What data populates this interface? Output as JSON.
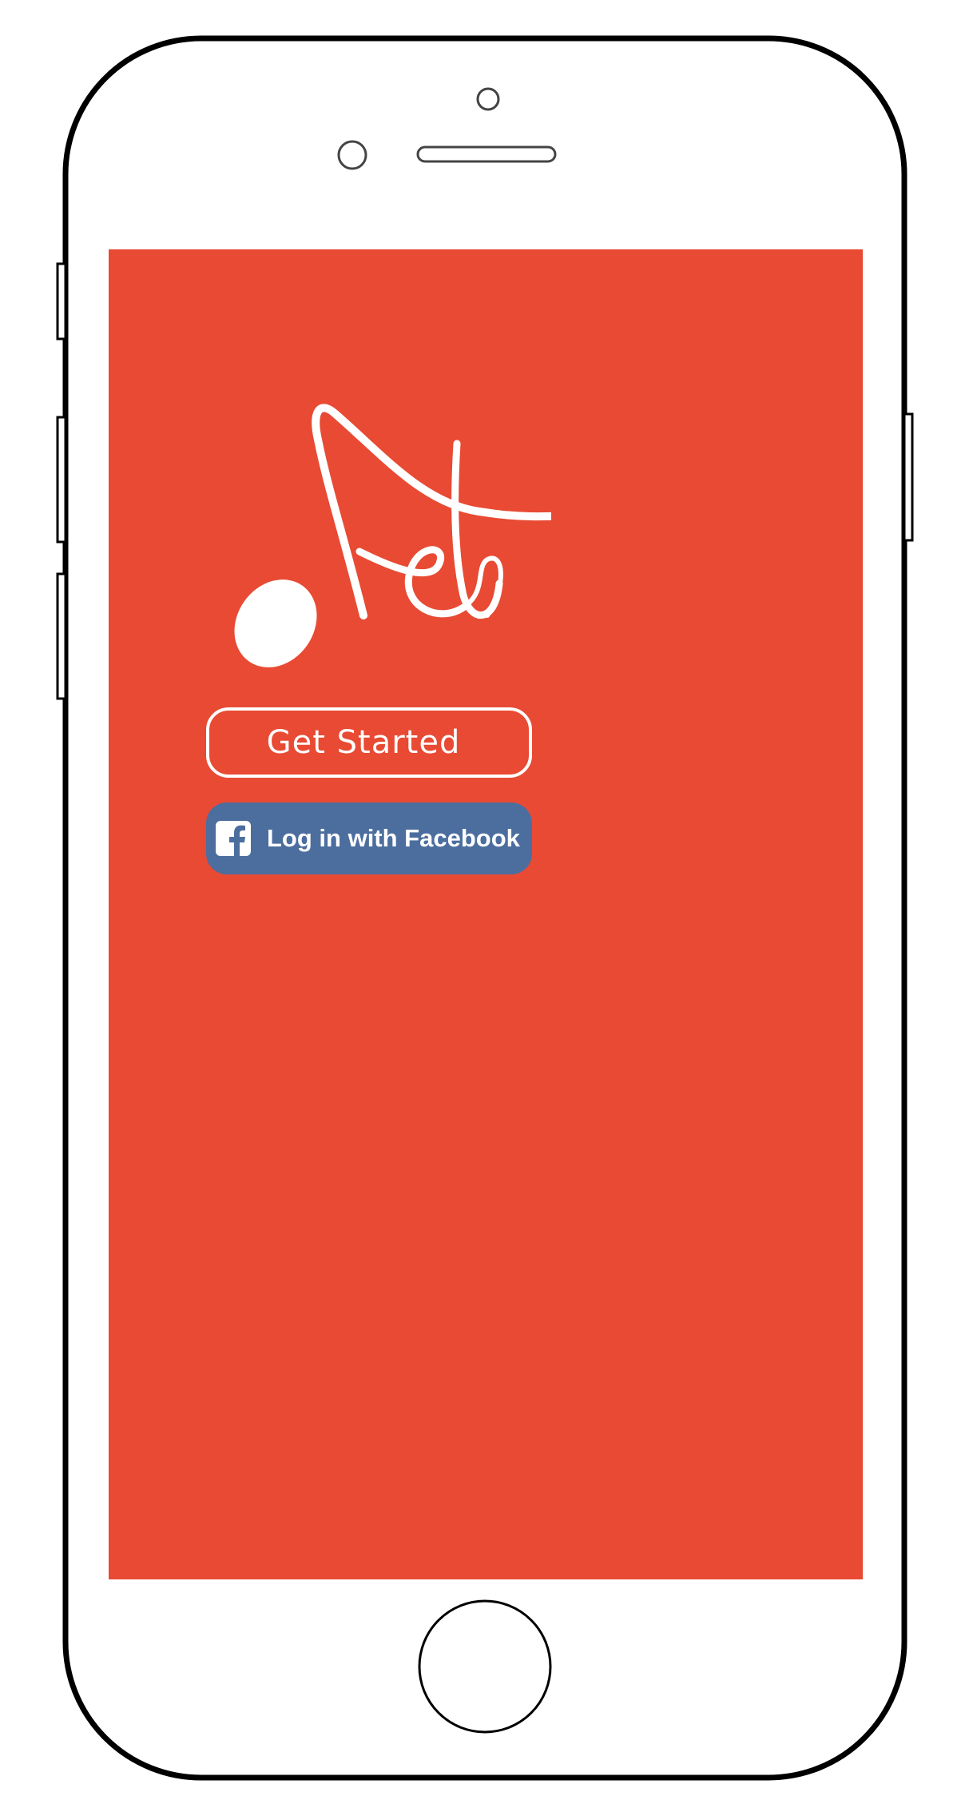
{
  "app": {
    "logo_name": "music-note-logo"
  },
  "buttons": {
    "get_started_label": "Get Started",
    "facebook_label": "Log in with Facebook"
  },
  "colors": {
    "screen_background": "#e84a33",
    "facebook_blue": "#4c6e9f",
    "foreground": "#ffffff"
  },
  "icons": {
    "facebook": "facebook-f-icon"
  }
}
